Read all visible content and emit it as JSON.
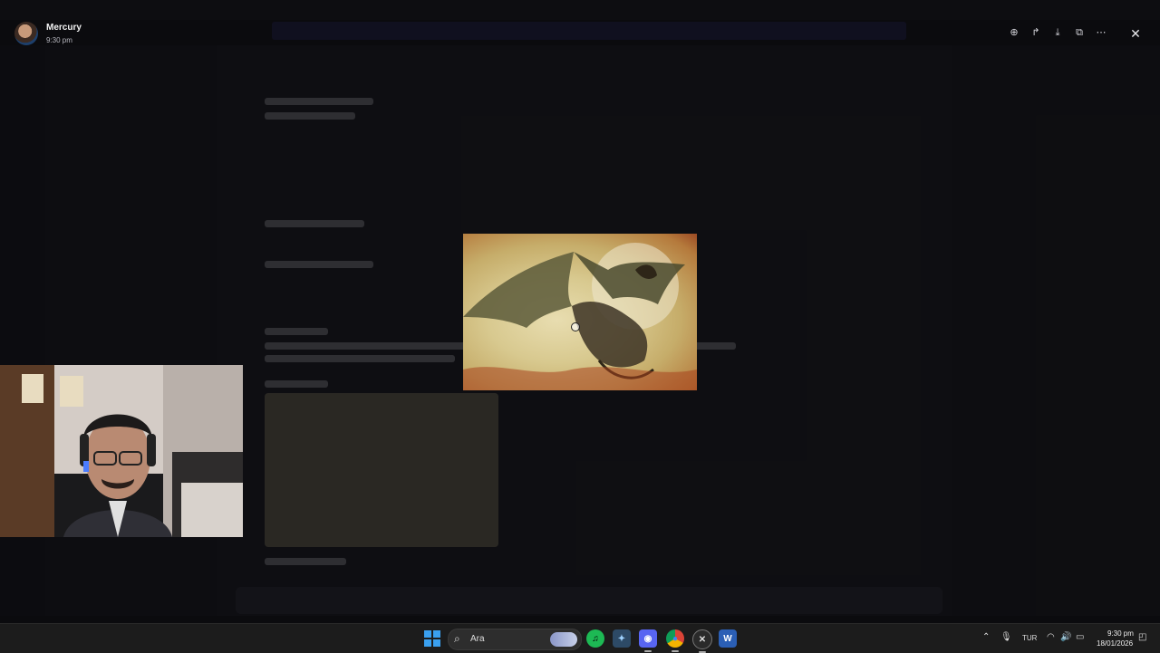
{
  "viewer": {
    "user_name": "Mercury",
    "timestamp": "9:30 pm",
    "actions": [
      {
        "name": "zoom-in-button",
        "icon": "zoom-in-icon",
        "glyph": "⊕"
      },
      {
        "name": "forward-button",
        "icon": "forward-icon",
        "glyph": "↱"
      },
      {
        "name": "download-button",
        "icon": "download-icon",
        "glyph": "⤓"
      },
      {
        "name": "open-external-button",
        "icon": "external-link-icon",
        "glyph": "⧉"
      },
      {
        "name": "more-button",
        "icon": "more-icon",
        "glyph": "⋯"
      }
    ],
    "close_glyph": "✕"
  },
  "taskbar": {
    "search_placeholder": "Ara",
    "search_glyph": "⌕",
    "apps": [
      {
        "name": "spotify-app",
        "glyph": "♫",
        "color": "#1db954",
        "active": false
      },
      {
        "name": "game-launcher-app",
        "glyph": "✦",
        "color": "#4a8fbf",
        "active": false
      },
      {
        "name": "discord-app",
        "glyph": "◉",
        "color": "#5865f2",
        "active": true
      },
      {
        "name": "chrome-app",
        "glyph": "●",
        "color": "#e8b21a",
        "active": true
      },
      {
        "name": "extension-app",
        "glyph": "✕",
        "color": "#c0c0c0",
        "active": true
      },
      {
        "name": "word-app",
        "glyph": "W",
        "color": "#2b5fb5",
        "active": false
      }
    ],
    "tray": {
      "chevron": "⌃",
      "mic": "🎙",
      "language": "TUR",
      "wifi": "◠",
      "volume": "🔊",
      "battery": "▭",
      "notification": "◰"
    },
    "time": "9:30 pm",
    "date": "18/01/2026"
  }
}
